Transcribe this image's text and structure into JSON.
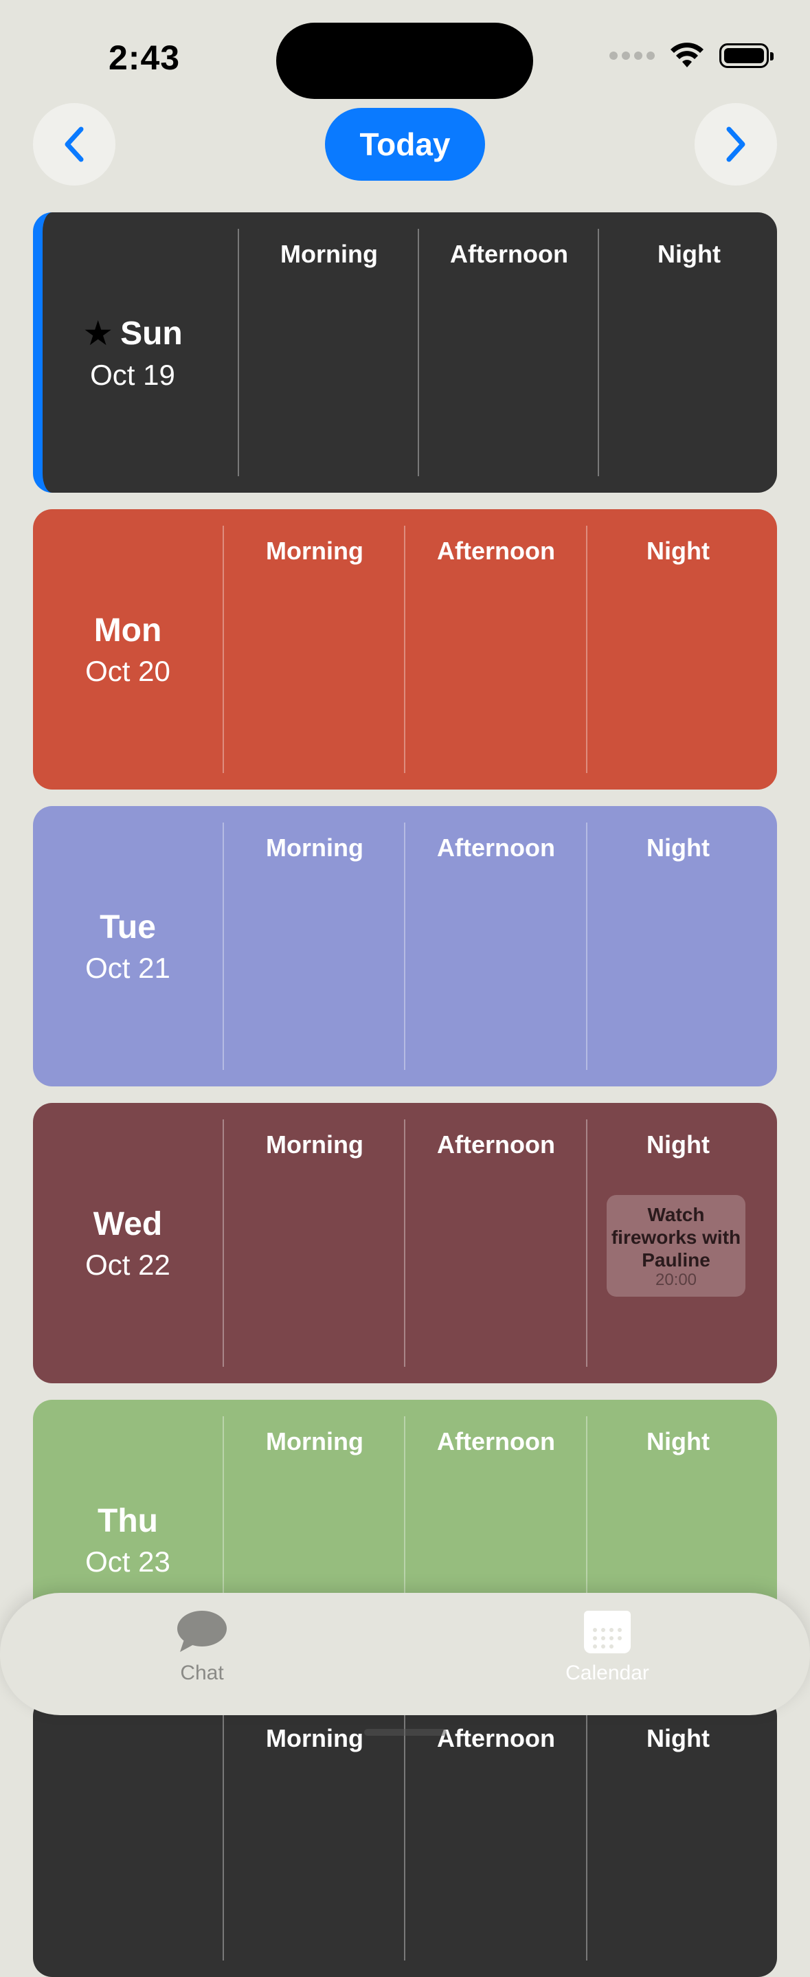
{
  "status": {
    "time": "2:43"
  },
  "nav": {
    "today_label": "Today",
    "prev_icon": "chevron-left-icon",
    "next_icon": "chevron-right-icon"
  },
  "colors": {
    "accent": "#0a7aff"
  },
  "slot_titles": {
    "morning": "Morning",
    "afternoon": "Afternoon",
    "night": "Night"
  },
  "days": [
    {
      "name": "Sun",
      "date": "Oct 19",
      "today": true,
      "color": "#323232"
    },
    {
      "name": "Mon",
      "date": "Oct 20",
      "color": "#cd513b"
    },
    {
      "name": "Tue",
      "date": "Oct 21",
      "color": "#8f97d5"
    },
    {
      "name": "Wed",
      "date": "Oct 22",
      "color": "#7b464b",
      "event": {
        "title": "Watch fireworks with Pauline",
        "time": "20:00"
      }
    },
    {
      "name": "Thu",
      "date": "Oct 23",
      "color": "#96bd7e"
    },
    {
      "color": "#323232"
    }
  ],
  "tabs": [
    {
      "label": "Chat",
      "icon": "chat-bubble-icon"
    },
    {
      "label": "Calendar",
      "icon": "calendar-icon",
      "selected": true
    }
  ]
}
